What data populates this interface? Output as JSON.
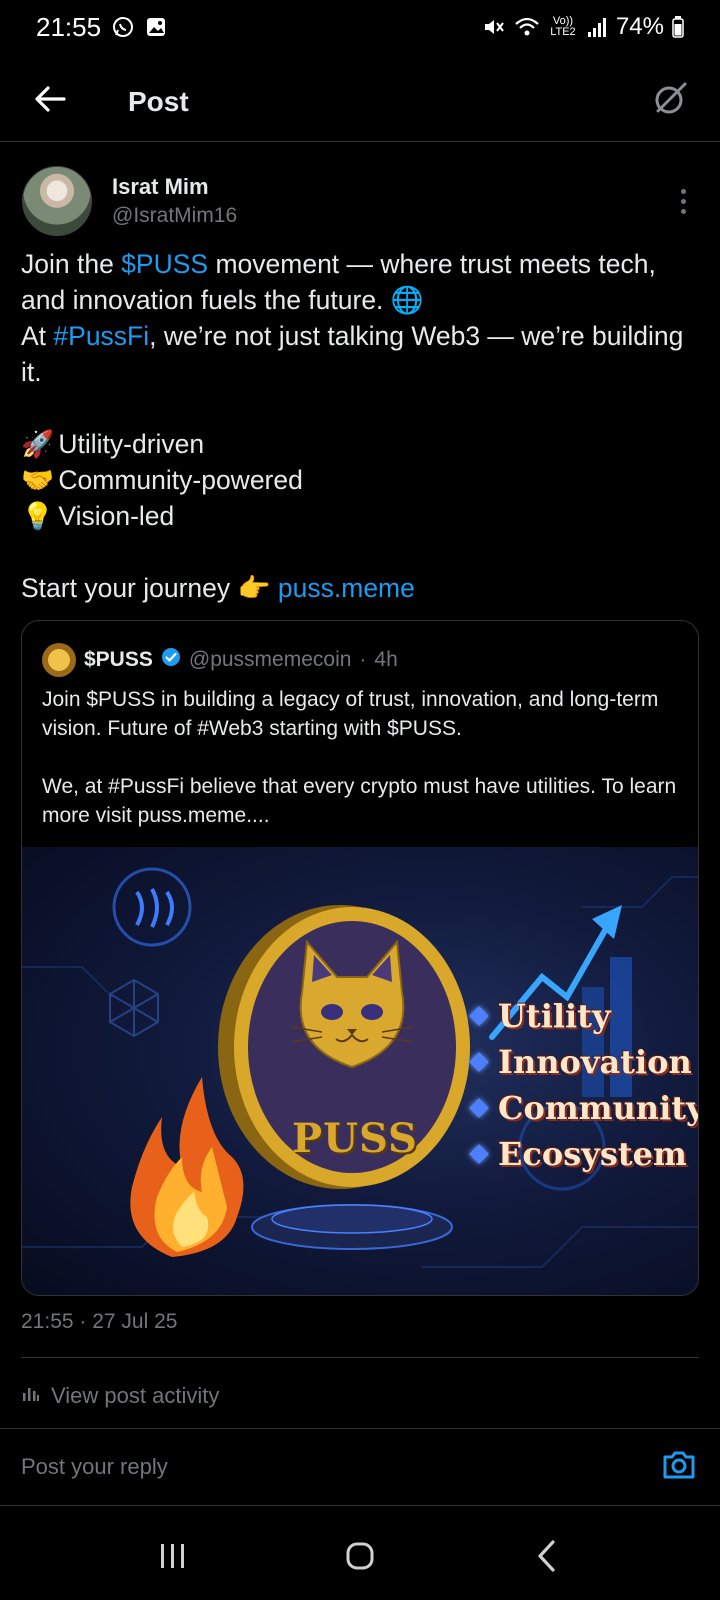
{
  "status_bar": {
    "time": "21:55",
    "battery": "74%",
    "network": "Vo)) LTE2",
    "icons": [
      "whatsapp-icon",
      "gallery-icon",
      "mute-icon",
      "wifi-icon",
      "signal-icon",
      "battery-icon"
    ]
  },
  "topnav": {
    "title": "Post",
    "back_icon": "back-arrow-icon",
    "grok_icon": "grok-icon"
  },
  "author": {
    "name": "Israt Mim",
    "handle": "@IsratMim16"
  },
  "post": {
    "line1_pre": "Join the ",
    "line1_link": "$PUSS",
    "line1_post": " movement — where trust meets tech, and innovation fuels the future. ",
    "line1_emoji": "🌐",
    "line2_pre": "At ",
    "line2_link": "#PussFi",
    "line2_post": ", we’re not just talking Web3 — we’re building it.",
    "bullets": [
      {
        "emoji": "🚀",
        "text": "Utility-driven"
      },
      {
        "emoji": "🤝",
        "text": "Community-powered"
      },
      {
        "emoji": "💡",
        "text": "Vision-led"
      }
    ],
    "cta_pre": "Start your journey ",
    "cta_emoji": "👉",
    "cta_link": "puss.meme"
  },
  "quote": {
    "name": "$PUSS",
    "handle": "@pussmemecoin",
    "separator": "·",
    "age": "4h",
    "para1": "Join $PUSS in building a legacy of trust, innovation, and long-term vision. Future of #Web3 starting with $PUSS.",
    "para2": "We, at #PussFi believe that every crypto must have utilities. To learn more visit puss.meme....",
    "image": {
      "coin_text": "PUSS",
      "bullets": [
        "Utility",
        "Innovation",
        "Community",
        "Ecosystem"
      ]
    }
  },
  "timestamp": "21:55 · 27 Jul 25",
  "activity": {
    "label": "View post activity"
  },
  "reply": {
    "placeholder": "Post your reply"
  },
  "colors": {
    "accent": "#1d9bf0",
    "background": "#000000",
    "text": "#e7e9ea",
    "muted": "#71767b",
    "divider": "#2f3336"
  }
}
